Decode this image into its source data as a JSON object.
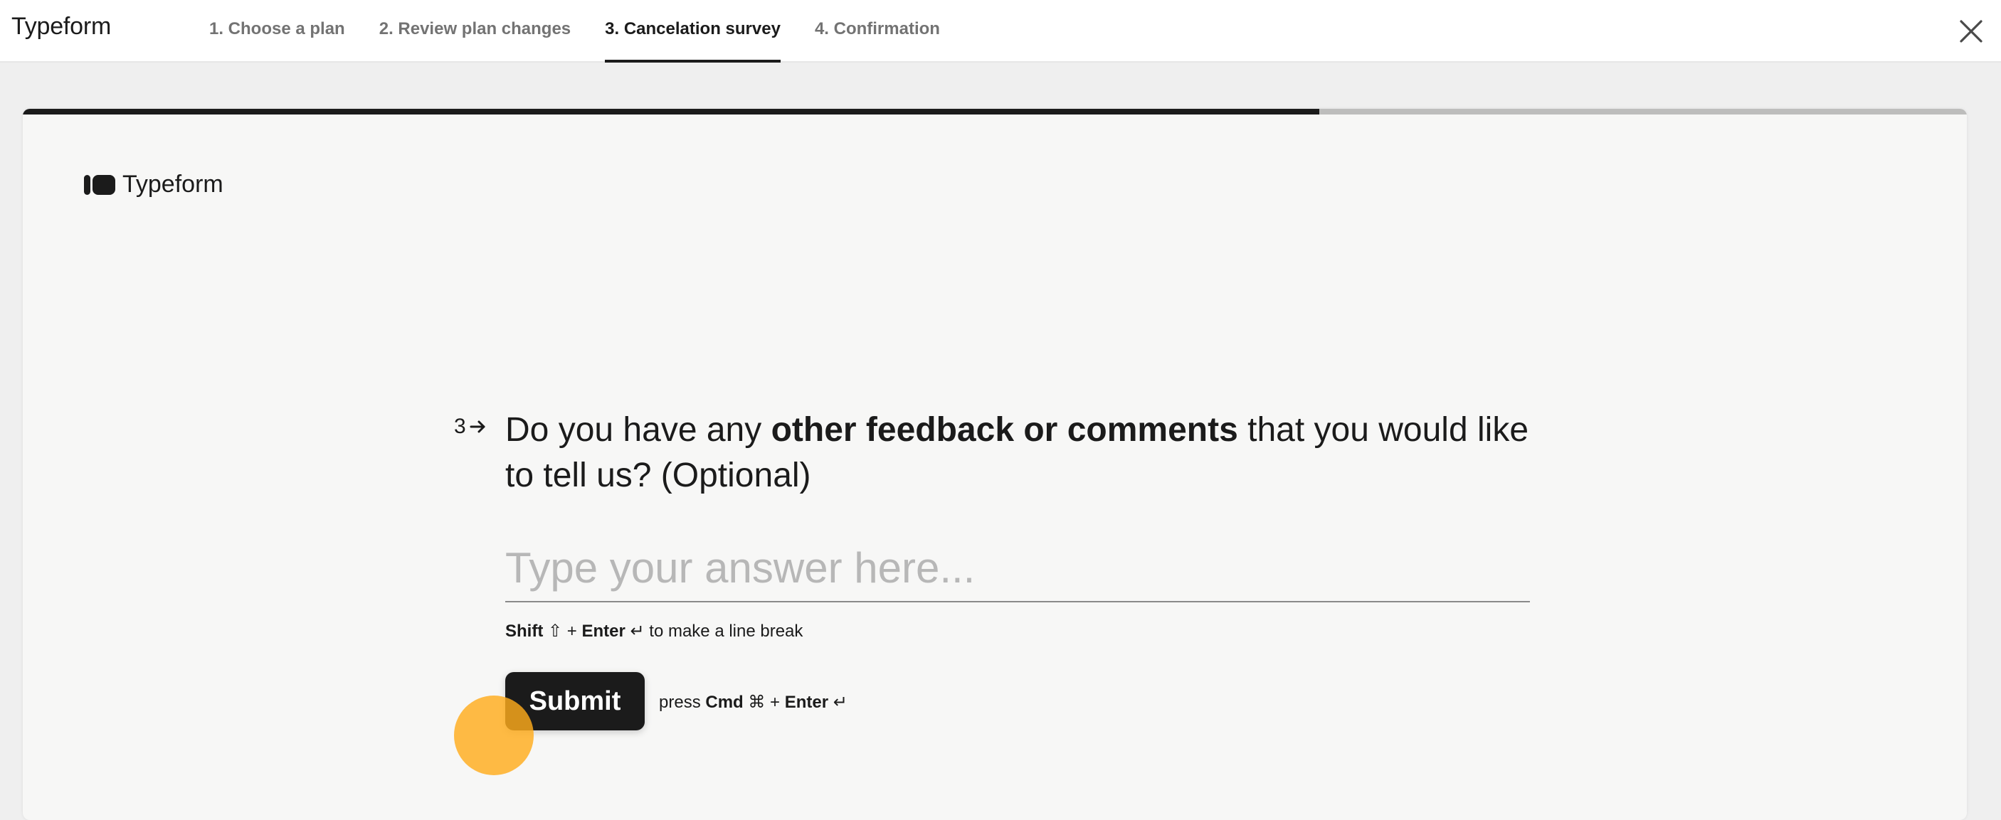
{
  "app": {
    "brand": "Typeform",
    "close_label": "×"
  },
  "steps": [
    {
      "label": "1. Choose a plan",
      "active": false
    },
    {
      "label": "2. Review plan changes",
      "active": false
    },
    {
      "label": "3. Cancelation survey",
      "active": true
    },
    {
      "label": "4. Confirmation",
      "active": false
    }
  ],
  "form": {
    "logo_text": "Typeform",
    "progress": 0.667,
    "question": {
      "number": "3",
      "text_before": "Do you have any",
      "text_bold": "other feedback or comments",
      "text_after": "that you would like to tell us? (Optional)"
    },
    "answer": {
      "value": "",
      "placeholder": "Type your answer here..."
    },
    "hint": {
      "key1": "Shift",
      "key1_symbol": "⇧",
      "plus": "+",
      "key2": "Enter",
      "key2_symbol": "↵",
      "text": "to make a line break"
    },
    "submit_label": "Submit",
    "press_hint": {
      "prefix": "press",
      "key1": "Cmd",
      "key1_symbol": "⌘",
      "plus": "+",
      "key2": "Enter",
      "key2_symbol": "↵"
    }
  },
  "colors": {
    "accent": "#1b1b1b",
    "background": "#efefef",
    "card": "#f7f7f6",
    "cursor": "#ffac1c"
  }
}
